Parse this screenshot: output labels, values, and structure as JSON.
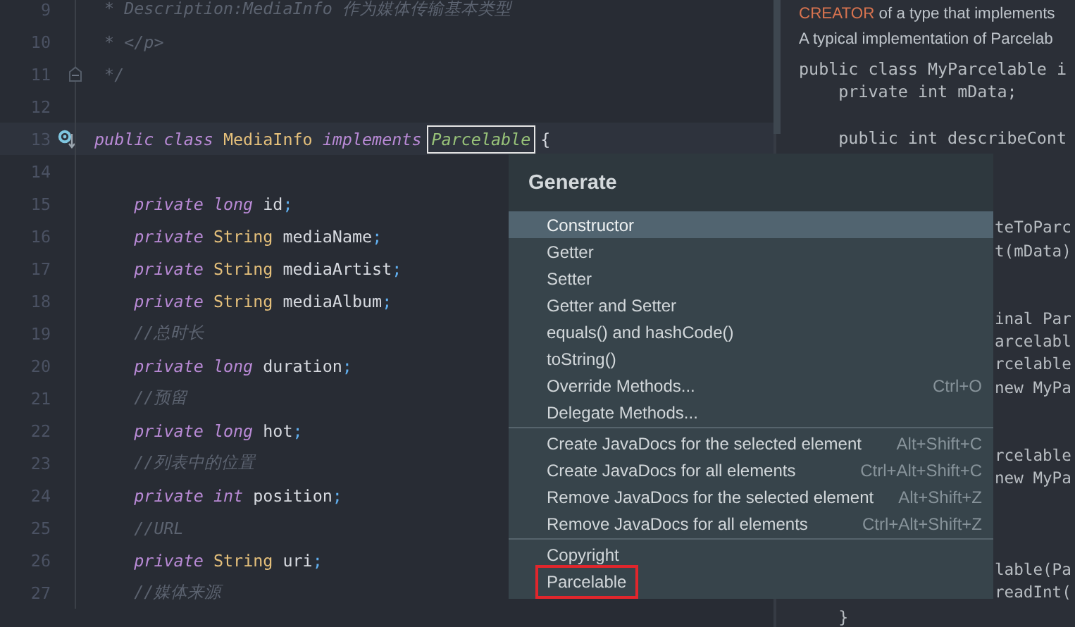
{
  "editor": {
    "lines": [
      {
        "number": "9",
        "tokens": [
          {
            "kind": "comment",
            "s": " * Description:MediaInfo 作为媒体传输基本类型"
          }
        ]
      },
      {
        "number": "10",
        "tokens": [
          {
            "kind": "comment",
            "s": " * </p>"
          }
        ]
      },
      {
        "number": "11",
        "fold_marker": true,
        "tokens": [
          {
            "kind": "comment",
            "s": " */"
          }
        ]
      },
      {
        "number": "12"
      },
      {
        "number": "13",
        "current": true,
        "gutter_icon": true,
        "tokens": [
          {
            "kind": "kw",
            "s": "public class "
          },
          {
            "kind": "cls",
            "s": "MediaInfo "
          },
          {
            "kind": "kw",
            "s": "implements "
          },
          {
            "kind": "iface",
            "s": "Parcelable"
          },
          {
            "kind": "name",
            "s": " {"
          }
        ]
      },
      {
        "number": "14"
      },
      {
        "number": "15",
        "tokens": [
          {
            "kind": "kw",
            "s": "    private long "
          },
          {
            "kind": "name",
            "s": "id"
          },
          {
            "kind": "punct",
            "s": ";"
          }
        ]
      },
      {
        "number": "16",
        "tokens": [
          {
            "kind": "kw",
            "s": "    private "
          },
          {
            "kind": "type",
            "s": "String "
          },
          {
            "kind": "name",
            "s": "mediaName"
          },
          {
            "kind": "punct",
            "s": ";"
          }
        ]
      },
      {
        "number": "17",
        "tokens": [
          {
            "kind": "kw",
            "s": "    private "
          },
          {
            "kind": "type",
            "s": "String "
          },
          {
            "kind": "name",
            "s": "mediaArtist"
          },
          {
            "kind": "punct",
            "s": ";"
          }
        ]
      },
      {
        "number": "18",
        "tokens": [
          {
            "kind": "kw",
            "s": "    private "
          },
          {
            "kind": "type",
            "s": "String "
          },
          {
            "kind": "name",
            "s": "mediaAlbum"
          },
          {
            "kind": "punct",
            "s": ";"
          }
        ]
      },
      {
        "number": "19",
        "tokens": [
          {
            "kind": "comment",
            "s": "    //总时长"
          }
        ]
      },
      {
        "number": "20",
        "tokens": [
          {
            "kind": "kw",
            "s": "    private long "
          },
          {
            "kind": "name",
            "s": "duration"
          },
          {
            "kind": "punct",
            "s": ";"
          }
        ]
      },
      {
        "number": "21",
        "tokens": [
          {
            "kind": "comment",
            "s": "    //预留"
          }
        ]
      },
      {
        "number": "22",
        "tokens": [
          {
            "kind": "kw",
            "s": "    private long "
          },
          {
            "kind": "name",
            "s": "hot"
          },
          {
            "kind": "punct",
            "s": ";"
          }
        ]
      },
      {
        "number": "23",
        "tokens": [
          {
            "kind": "comment",
            "s": "    //列表中的位置"
          }
        ]
      },
      {
        "number": "24",
        "tokens": [
          {
            "kind": "kw",
            "s": "    private int "
          },
          {
            "kind": "name",
            "s": "position"
          },
          {
            "kind": "punct",
            "s": ";"
          }
        ]
      },
      {
        "number": "25",
        "tokens": [
          {
            "kind": "comment",
            "s": "    //URL"
          }
        ]
      },
      {
        "number": "26",
        "tokens": [
          {
            "kind": "kw",
            "s": "    private "
          },
          {
            "kind": "type",
            "s": "String "
          },
          {
            "kind": "name",
            "s": "uri"
          },
          {
            "kind": "punct",
            "s": ";"
          }
        ]
      },
      {
        "number": "27",
        "tokens": [
          {
            "kind": "comment",
            "s": "    //媒体来源"
          }
        ]
      }
    ]
  },
  "documentation": {
    "paragraphs": [
      {
        "lead": "CREATOR",
        "text": " of a type that implements"
      },
      {
        "text": "A typical implementation of Parcelab"
      }
    ],
    "code_lines": [
      {
        "kind": "full",
        "s": "public class MyParcelable i"
      },
      {
        "kind": "full",
        "s": "    private int mData;"
      },
      {
        "kind": "blank"
      },
      {
        "kind": "full",
        "s": "    public int describeCont"
      },
      {
        "kind": "blank"
      },
      {
        "kind": "blank"
      },
      {
        "kind": "blank"
      },
      {
        "kind": "clipped",
        "s": "teToParc"
      },
      {
        "kind": "clipped",
        "s": "t(mData)"
      },
      {
        "kind": "blank"
      },
      {
        "kind": "blank"
      },
      {
        "kind": "clipped",
        "s": "inal Par"
      },
      {
        "kind": "clipped",
        "s": "arcelabl"
      },
      {
        "kind": "clipped",
        "s": "rcelable"
      },
      {
        "kind": "clipped",
        "s": "new MyPa"
      },
      {
        "kind": "blank"
      },
      {
        "kind": "blank"
      },
      {
        "kind": "clipped",
        "s": "rcelable"
      },
      {
        "kind": "clipped",
        "s": "new MyPa"
      },
      {
        "kind": "blank"
      },
      {
        "kind": "blank"
      },
      {
        "kind": "blank"
      },
      {
        "kind": "clipped",
        "s": "lable(Pa"
      },
      {
        "kind": "clipped",
        "s": "readInt("
      },
      {
        "kind": "full",
        "s": "    }"
      }
    ]
  },
  "generate_popup": {
    "title": "Generate",
    "groups": [
      {
        "items": [
          {
            "label": "Constructor",
            "selected": true
          },
          {
            "label": "Getter",
            "selected": false
          },
          {
            "label": "Setter",
            "selected": false
          },
          {
            "label": "Getter and Setter",
            "selected": false
          },
          {
            "label": "equals() and hashCode()",
            "selected": false
          },
          {
            "label": "toString()",
            "selected": false
          },
          {
            "label": "Override Methods...",
            "shortcut": "Ctrl+O",
            "selected": false
          },
          {
            "label": "Delegate Methods...",
            "selected": false
          }
        ]
      },
      {
        "items": [
          {
            "label": "Create JavaDocs for the selected element",
            "shortcut": "Alt+Shift+C",
            "selected": false
          },
          {
            "label": "Create JavaDocs for all elements",
            "shortcut": "Ctrl+Alt+Shift+C",
            "selected": false
          },
          {
            "label": "Remove JavaDocs for the selected element",
            "shortcut": "Alt+Shift+Z",
            "selected": false
          },
          {
            "label": "Remove JavaDocs for all elements",
            "shortcut": "Ctrl+Alt+Shift+Z",
            "selected": false
          }
        ]
      },
      {
        "items": [
          {
            "label": "Copyright",
            "selected": false
          },
          {
            "label": "Parcelable",
            "selected": false,
            "highlighted": true
          }
        ]
      }
    ]
  }
}
